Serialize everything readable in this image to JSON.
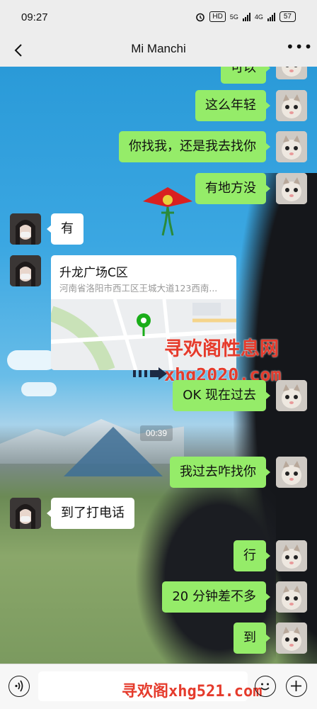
{
  "status_bar": {
    "time": "09:27",
    "network": "5G",
    "network2": "4G",
    "hd": "HD",
    "battery": "57"
  },
  "header": {
    "title": "Mi Manchi",
    "more": "•••"
  },
  "messages": [
    {
      "side": "out",
      "text": "可以"
    },
    {
      "side": "out",
      "text": "这么年轻"
    },
    {
      "side": "out",
      "text": "你找我，还是我去找你"
    },
    {
      "side": "out",
      "text": "有地方没"
    },
    {
      "side": "in",
      "text": "有"
    },
    {
      "side": "in",
      "type": "location",
      "name": "升龙广场C区",
      "address": "河南省洛阳市西工区王城大道123西南..."
    },
    {
      "side": "out",
      "text": "OK 现在过去"
    },
    {
      "side": "out",
      "text": "我过去咋找你"
    },
    {
      "side": "in",
      "text": "到了打电话"
    },
    {
      "side": "out",
      "text": "行"
    },
    {
      "side": "out",
      "text": "20 分钟差不多"
    },
    {
      "side": "out",
      "text": "到"
    }
  ],
  "timestamp": "00:39",
  "watermarks": {
    "line1": "寻欢阁性息网",
    "line2": "xhg2020.com",
    "bottom": "寻欢阁xhg521.com"
  },
  "input": {
    "value": ""
  },
  "colors": {
    "out_bubble": "#95ec69",
    "in_bubble": "#ffffff",
    "watermark": "#e53b2c"
  }
}
